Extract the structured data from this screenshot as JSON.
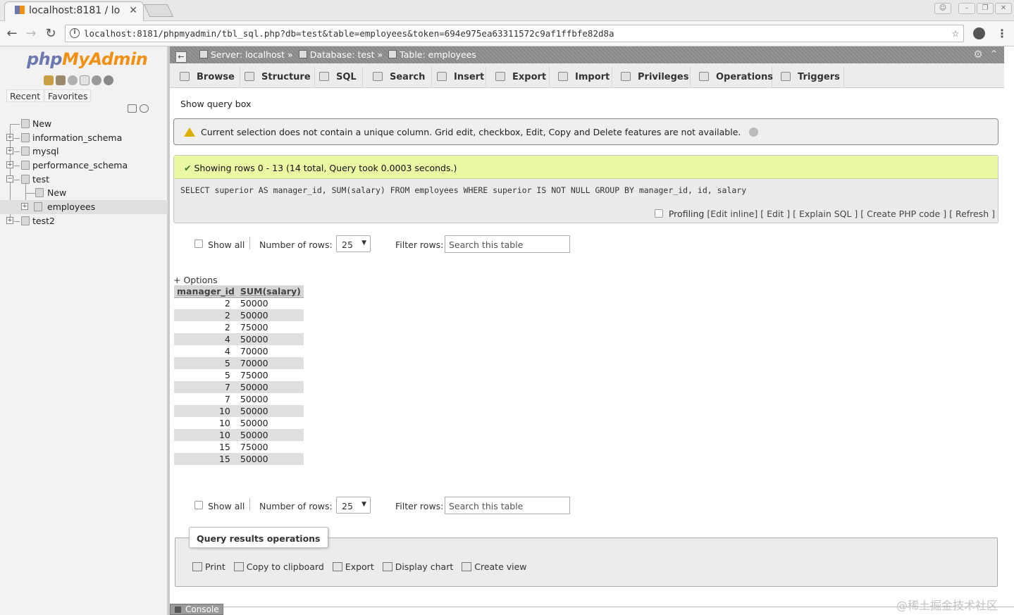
{
  "browser": {
    "tab_title": "localhost:8181 / lo",
    "url": "localhost:8181/phpmyadmin/tbl_sql.php?db=test&table=employees&token=694e975ea63311572c9af1ffbfe82d8a"
  },
  "logo": {
    "php": "php",
    "my": "My",
    "admin": "Admin"
  },
  "sidebar": {
    "recent": "Recent",
    "favorites": "Favorites",
    "tree": {
      "new": "New",
      "db1": "information_schema",
      "db2": "mysql",
      "db3": "performance_schema",
      "db4": "test",
      "db4_new": "New",
      "db4_table": "employees",
      "db5": "test2"
    }
  },
  "breadcrumb": {
    "server": "Server: localhost",
    "database": "Database: test",
    "table": "Table: employees",
    "sep": "»"
  },
  "tabs": [
    "Browse",
    "Structure",
    "SQL",
    "Search",
    "Insert",
    "Export",
    "Import",
    "Privileges",
    "Operations",
    "Triggers"
  ],
  "show_query_box": "Show query box",
  "notice": "Current selection does not contain a unique column. Grid edit, checkbox, Edit, Copy and Delete features are not available.",
  "success": {
    "message": "Showing rows 0 - 13 (14 total, Query took 0.0003 seconds.)",
    "sql": "SELECT superior AS manager_id, SUM(salary) FROM employees WHERE superior IS NOT NULL GROUP BY manager_id, id, salary",
    "profiling": "Profiling",
    "edit_inline": "[Edit inline]",
    "edit": "[ Edit ]",
    "explain": "[ Explain SQL ]",
    "create_php": "[ Create PHP code ]",
    "refresh": "[ Refresh ]"
  },
  "nav": {
    "show_all": "Show all",
    "number_of_rows": "Number of rows:",
    "rows_value": "25",
    "filter_rows": "Filter rows:",
    "filter_placeholder": "Search this table"
  },
  "options": "+ Options",
  "table": {
    "columns": [
      "manager_id",
      "SUM(salary)"
    ],
    "rows": [
      [
        "2",
        "50000"
      ],
      [
        "2",
        "50000"
      ],
      [
        "2",
        "75000"
      ],
      [
        "4",
        "50000"
      ],
      [
        "4",
        "70000"
      ],
      [
        "5",
        "70000"
      ],
      [
        "5",
        "75000"
      ],
      [
        "7",
        "50000"
      ],
      [
        "7",
        "50000"
      ],
      [
        "10",
        "50000"
      ],
      [
        "10",
        "50000"
      ],
      [
        "10",
        "50000"
      ],
      [
        "15",
        "75000"
      ],
      [
        "15",
        "50000"
      ]
    ]
  },
  "query_ops": {
    "legend": "Query results operations",
    "print": "Print",
    "copy": "Copy to clipboard",
    "export": "Export",
    "chart": "Display chart",
    "view": "Create view"
  },
  "console": "Console",
  "watermark": "@稀土掘金技术社区"
}
